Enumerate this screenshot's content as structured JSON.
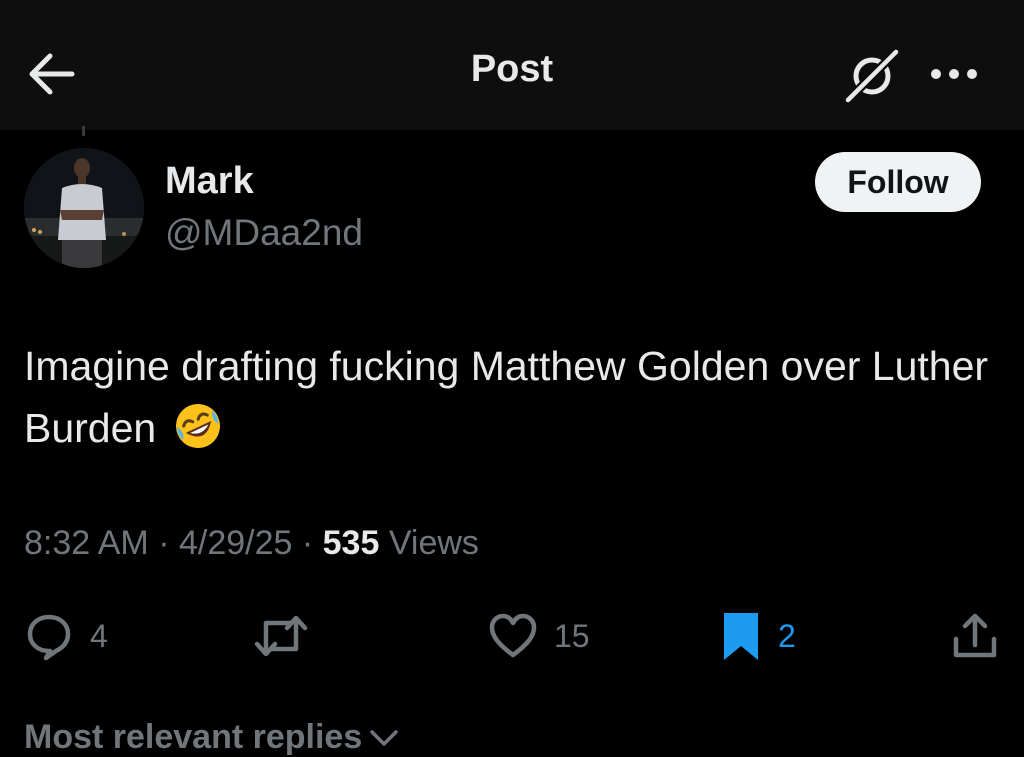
{
  "header": {
    "title": "Post",
    "back_icon": "arrow-left-icon",
    "grok_icon": "grok-icon",
    "more_icon": "more-dots-icon"
  },
  "author": {
    "display_name": "Mark",
    "handle": "@MDaa2nd",
    "follow_label": "Follow"
  },
  "post": {
    "text": "Imagine drafting fucking Matthew Golden over Luther Burden",
    "emoji": "rolling-on-floor-laughing-emoji",
    "time": "8:32 AM",
    "sep1": " · ",
    "date": "4/29/25",
    "sep2": " · ",
    "views_count": "535",
    "views_label": " Views"
  },
  "actions": {
    "replies": "4",
    "reposts": "",
    "likes": "15",
    "bookmarks": "2"
  },
  "replies_sort": {
    "label": "Most relevant replies"
  },
  "colors": {
    "background": "#000000",
    "text_primary": "#e7e9ea",
    "text_secondary": "#71767b",
    "accent_blue": "#1d9bf0",
    "follow_bg": "#eff3f4"
  }
}
